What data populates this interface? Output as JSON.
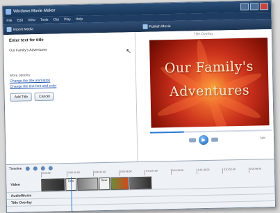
{
  "window": {
    "title": "Windows Movie Maker"
  },
  "menu": [
    "File",
    "Edit",
    "View",
    "Tools",
    "Clip",
    "Play",
    "Help"
  ],
  "toolbar": {
    "import": "Import Media",
    "publish": "Publish Movie"
  },
  "task_pane": {
    "heading": "Enter text for title",
    "title_text": "Our Family's Adventures",
    "more_options": "More options:",
    "links": [
      "Change the title animation",
      "Change the text font and color"
    ],
    "add_button": "Add Title",
    "cancel_button": "Cancel"
  },
  "preview": {
    "label": "Title Overlay",
    "line1": "Our Family's",
    "line2": "Adventures",
    "progress": 0.28,
    "split_label": "Split"
  },
  "timeline": {
    "label": "Timeline",
    "ticks": [
      "0:00:00",
      "0:00:16.00",
      "0:00:32.00",
      "0:00:48.00",
      "0:01:04.00",
      "0:01:20.00",
      "0:01:36.00",
      "0:01:52.00",
      "0:02:08.00"
    ],
    "tracks": {
      "video": "Video",
      "audio": "Audio/Music",
      "title": "Title Overlay"
    },
    "clip_labels": [
      "Edlo",
      "Bear"
    ]
  }
}
